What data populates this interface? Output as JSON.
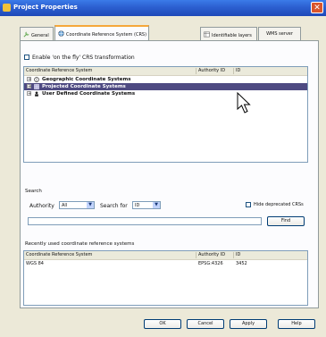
{
  "window": {
    "title": "Project Properties",
    "close_glyph": "✕"
  },
  "tabs": [
    {
      "label": "General",
      "icon": "wrench-icon"
    },
    {
      "label": "Coordinate Reference System (CRS)",
      "icon": "globe-icon"
    },
    {
      "label": "Identifiable layers",
      "icon": "table-icon"
    },
    {
      "label": "WMS server",
      "icon": ""
    }
  ],
  "crs": {
    "enable_otf_label": "Enable 'on the fly' CRS transformation",
    "columns": [
      "Coordinate Reference System",
      "Authority ID",
      "ID"
    ],
    "tree_items": [
      {
        "label": "Geographic Coordinate Systems",
        "expander": "+",
        "icon": "globe-icon",
        "selected": false
      },
      {
        "label": "Projected Coordinate Systems",
        "expander": "+",
        "icon": "grid-icon",
        "selected": true
      },
      {
        "label": "User Defined Coordinate Systems",
        "expander": "+",
        "icon": "user-icon",
        "selected": false
      }
    ]
  },
  "search": {
    "section_label": "Search",
    "authority_label": "Authority",
    "authority_value": "All",
    "search_for_label": "Search for",
    "search_for_value": "ID",
    "hide_deprecated_label": "Hide deprecated CRSs",
    "input_value": "",
    "find_label": "Find",
    "arrow_glyph": "▼"
  },
  "recent": {
    "section_label": "Recently used coordinate reference systems",
    "columns": [
      "Coordinate Reference System",
      "Authority ID",
      "ID"
    ],
    "rows": [
      {
        "name": "WGS 84",
        "authority": "EPSG:4326",
        "id": "3452"
      }
    ]
  },
  "buttons": {
    "ok": "OK",
    "cancel": "Cancel",
    "apply": "Apply",
    "help": "Help"
  },
  "colors": {
    "title_bar": "#2c5fd0",
    "selection": "#4e4a82",
    "dialog_bg": "#ece9d8"
  }
}
